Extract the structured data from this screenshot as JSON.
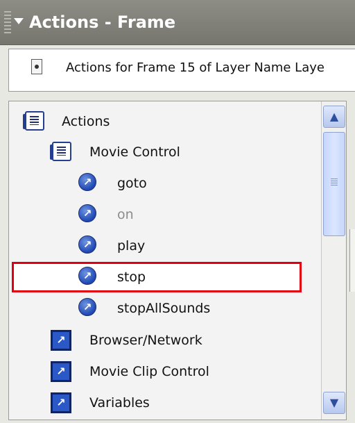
{
  "panel": {
    "title": "Actions - Frame",
    "frame_info": "Actions for Frame 15 of Layer Name Laye"
  },
  "tree": {
    "root": {
      "label": "Actions",
      "icon": "book-icon"
    },
    "movie_control": {
      "label": "Movie Control",
      "icon": "book-icon",
      "items": [
        {
          "label": "goto",
          "icon": "action-arrow-icon",
          "dimmed": false
        },
        {
          "label": "on",
          "icon": "action-arrow-icon",
          "dimmed": true
        },
        {
          "label": "play",
          "icon": "action-arrow-icon",
          "dimmed": false
        },
        {
          "label": "stop",
          "icon": "action-arrow-icon",
          "dimmed": false,
          "highlighted": true
        },
        {
          "label": "stopAllSounds",
          "icon": "action-arrow-icon",
          "dimmed": false
        }
      ]
    },
    "categories": [
      {
        "label": "Browser/Network",
        "icon": "category-arrow-icon"
      },
      {
        "label": "Movie Clip Control",
        "icon": "category-arrow-icon"
      },
      {
        "label": "Variables",
        "icon": "category-arrow-icon"
      }
    ]
  },
  "colors": {
    "highlight": "#e3000e",
    "titlebar": "#7f7f78",
    "icon_blue": "#1f47b4"
  }
}
